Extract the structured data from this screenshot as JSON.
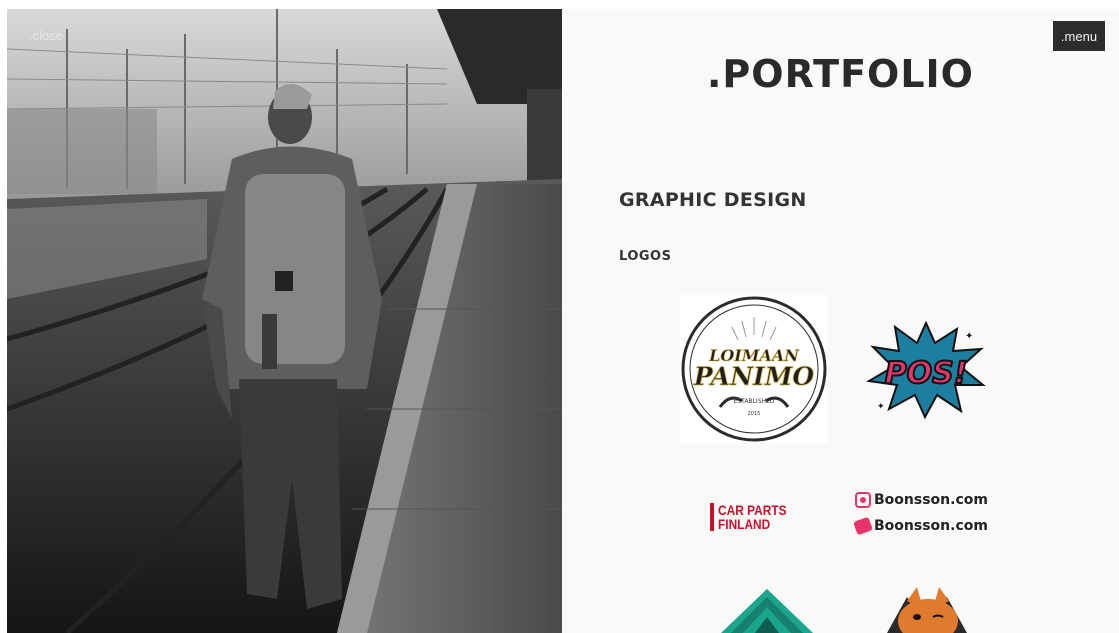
{
  "photo_panel": {
    "close_label": ".close"
  },
  "header": {
    "menu_label": ".menu",
    "title": ".PORTFOLIO"
  },
  "portfolio": {
    "section": "GRAPHIC DESIGN",
    "subsection": "LOGOS",
    "logos": [
      {
        "icon": "loimaan-panimo-logo",
        "wordmark_top": "LOIMAAN",
        "wordmark_main": "PANIMO",
        "sub": "ESTABLISHED",
        "year": "2015"
      },
      {
        "icon": "pos-logo",
        "text": "POS!"
      },
      {
        "icon": "car-parts-finland-logo",
        "line1": "CAR PARTS",
        "line2": "FINLAND"
      },
      {
        "icon": "boonsson-logo",
        "text_a": "Boonsson.com",
        "text_b": "Boonsson.com"
      },
      {
        "icon": "triangle-logo"
      },
      {
        "icon": "fox-logo"
      }
    ]
  },
  "colors": {
    "panel_bg": "#f9f9f7",
    "menu_bg": "#2c2c2c",
    "title": "#2a2a2a",
    "pos_pink": "#e8336b",
    "car_parts_red": "#c8102e",
    "teal": "#1aa58c",
    "fox_orange": "#e07a2f"
  }
}
